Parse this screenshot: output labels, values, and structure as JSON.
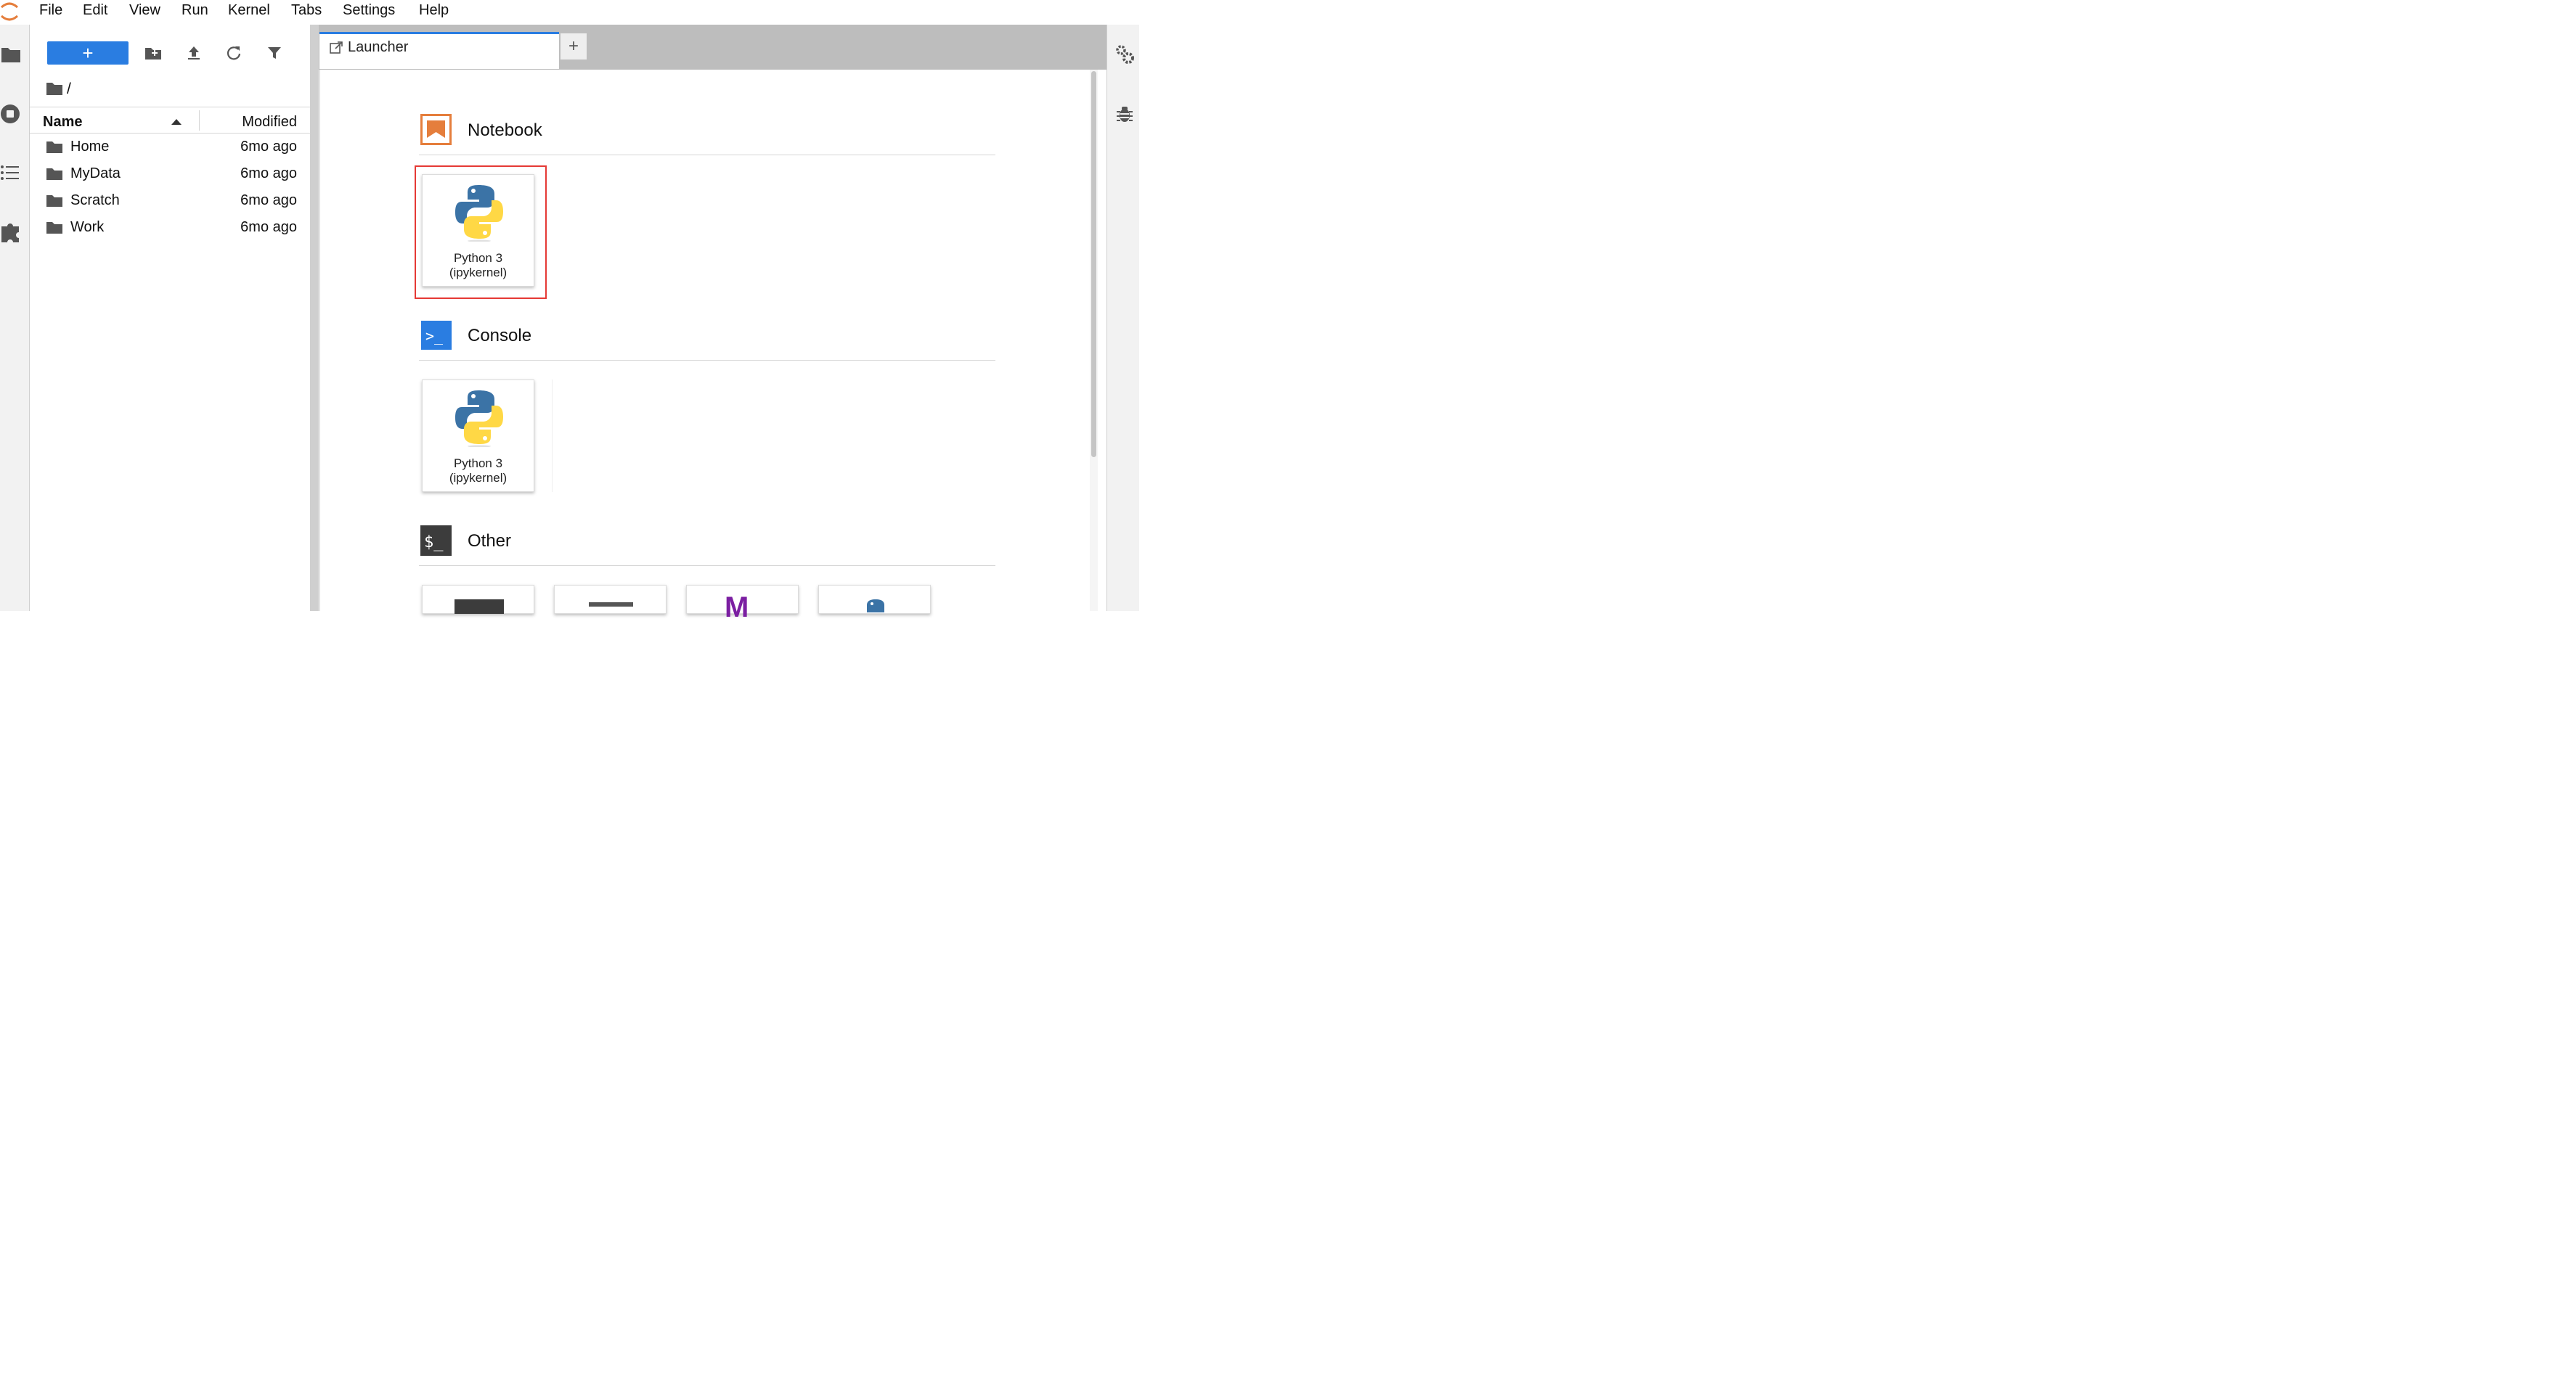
{
  "menu": [
    "File",
    "Edit",
    "View",
    "Run",
    "Kernel",
    "Tabs",
    "Settings",
    "Help"
  ],
  "filebrowser": {
    "new_button_label": "+",
    "path": "/",
    "columns": {
      "name": "Name",
      "modified": "Modified"
    },
    "rows": [
      {
        "name": "Home",
        "modified": "6mo ago"
      },
      {
        "name": "MyData",
        "modified": "6mo ago"
      },
      {
        "name": "Scratch",
        "modified": "6mo ago"
      },
      {
        "name": "Work",
        "modified": "6mo ago"
      }
    ]
  },
  "tabs": {
    "active_label": "Launcher",
    "add_label": "+"
  },
  "launcher": {
    "sections": [
      {
        "title": "Notebook",
        "card_label": "Python 3\n(ipykernel)"
      },
      {
        "title": "Console",
        "card_label": "Python 3\n(ipykernel)"
      },
      {
        "title": "Other"
      }
    ],
    "console_icon_text": ">_",
    "other_icon_text": "$_",
    "markdown_icon_text": "M"
  },
  "colors": {
    "accent": "#2a7de1",
    "notebook_orange": "#e57e3c",
    "highlight_red": "#e53935",
    "dark_icon": "#3c3c3c",
    "markdown_purple": "#7b1fa2"
  }
}
